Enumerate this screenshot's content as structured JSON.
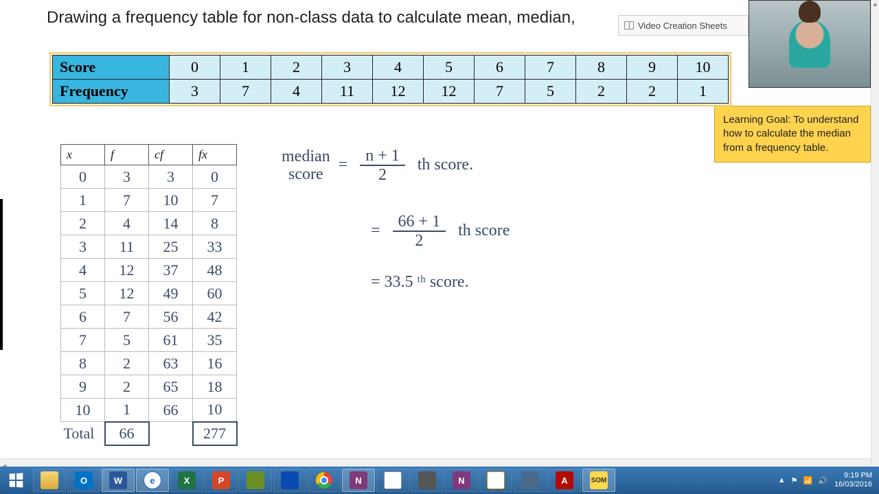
{
  "title": "Drawing a frequency table for non-class data to calculate mean, median,",
  "window_tab": {
    "label": "Video Creation Sheets"
  },
  "learning_goal": "Learning Goal: To understand how to calculate the median from a frequency table.",
  "score_table": {
    "row1_label": "Score",
    "row2_label": "Frequency",
    "scores": [
      "0",
      "1",
      "2",
      "3",
      "4",
      "5",
      "6",
      "7",
      "8",
      "9",
      "10"
    ],
    "frequencies": [
      "3",
      "7",
      "4",
      "11",
      "12",
      "12",
      "7",
      "5",
      "2",
      "2",
      "1"
    ]
  },
  "freq_table": {
    "headers": [
      "x",
      "f",
      "cf",
      "fx"
    ],
    "rows": [
      {
        "x": "0",
        "f": "3",
        "cf": "3",
        "fx": "0"
      },
      {
        "x": "1",
        "f": "7",
        "cf": "10",
        "fx": "7"
      },
      {
        "x": "2",
        "f": "4",
        "cf": "14",
        "fx": "8"
      },
      {
        "x": "3",
        "f": "11",
        "cf": "25",
        "fx": "33"
      },
      {
        "x": "4",
        "f": "12",
        "cf": "37",
        "fx": "48"
      },
      {
        "x": "5",
        "f": "12",
        "cf": "49",
        "fx": "60"
      },
      {
        "x": "6",
        "f": "7",
        "cf": "56",
        "fx": "42"
      },
      {
        "x": "7",
        "f": "5",
        "cf": "61",
        "fx": "35"
      },
      {
        "x": "8",
        "f": "2",
        "cf": "63",
        "fx": "16"
      },
      {
        "x": "9",
        "f": "2",
        "cf": "65",
        "fx": "18"
      },
      {
        "x": "10",
        "f": "1",
        "cf": "66",
        "fx": "10"
      }
    ],
    "total_label": "Total",
    "total_f": "66",
    "total_fx": "277"
  },
  "handwriting": {
    "line1_lhs_top": "median",
    "line1_lhs_bot": "score",
    "eq": "=",
    "line1_num": "n + 1",
    "line1_den": "2",
    "line1_suffix": "th  score.",
    "line2_num": "66 + 1",
    "line2_den": "2",
    "line2_suffix": "th  score",
    "line3": "= 33.5 ᵗʰ  score."
  },
  "taskbar": {
    "apps": [
      {
        "name": "file-explorer",
        "label": "",
        "cls": "ic-explorer"
      },
      {
        "name": "outlook",
        "label": "O",
        "cls": "ic-outlook"
      },
      {
        "name": "word",
        "label": "W",
        "cls": "ic-word",
        "active": true
      },
      {
        "name": "internet-explorer",
        "label": "e",
        "cls": "ic-ie",
        "active": true
      },
      {
        "name": "excel",
        "label": "X",
        "cls": "ic-excel"
      },
      {
        "name": "powerpoint",
        "label": "P",
        "cls": "ic-ppt"
      },
      {
        "name": "publisher",
        "label": "",
        "cls": "ic-pub"
      },
      {
        "name": "onedrive",
        "label": "",
        "cls": "ic-onedrive"
      },
      {
        "name": "chrome",
        "label": "",
        "cls": "ic-chrome"
      },
      {
        "name": "onenote",
        "label": "N",
        "cls": "ic-onenote",
        "active": true
      },
      {
        "name": "notepad",
        "label": "",
        "cls": "ic-notepad"
      },
      {
        "name": "calculator",
        "label": "",
        "cls": "ic-calc"
      },
      {
        "name": "onenote-2",
        "label": "N",
        "cls": "ic-onenote2"
      },
      {
        "name": "snipping-tool",
        "label": "",
        "cls": "ic-snip"
      },
      {
        "name": "app-generic",
        "label": "",
        "cls": "ic-generic"
      },
      {
        "name": "adobe-reader",
        "label": "A",
        "cls": "ic-pdf"
      },
      {
        "name": "som",
        "label": "SOM",
        "cls": "ic-som",
        "active": true
      }
    ],
    "time": "9:19 PM",
    "date": "16/03/2016"
  }
}
